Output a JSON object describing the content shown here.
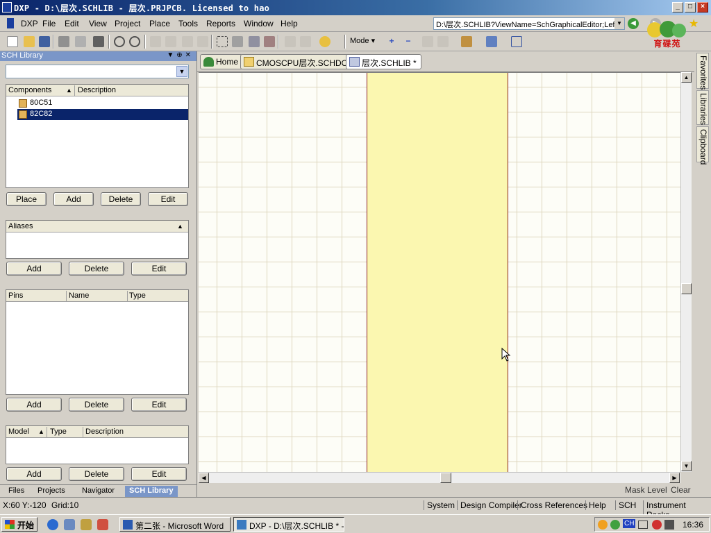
{
  "window": {
    "title": "DXP - D:\\层次.SCHLIB - 层次.PRJPCB. Licensed to hao",
    "min": "_",
    "max": "□",
    "close": "×"
  },
  "menu": {
    "items": [
      "DXP",
      "File",
      "Edit",
      "View",
      "Project",
      "Place",
      "Tools",
      "Reports",
      "Window",
      "Help"
    ],
    "path": "D:\\层次.SCHLIB?ViewName=SchGraphicalEditor;Left="
  },
  "toolbar": {
    "mode_label": "Mode ▾"
  },
  "logo": {
    "text": "育碟苑"
  },
  "panel": {
    "title": "SCH Library",
    "components": {
      "headers": [
        "Components",
        "Description"
      ],
      "items": [
        "80C51",
        "82C82"
      ],
      "selected_index": 1,
      "buttons": [
        "Place",
        "Add",
        "Delete",
        "Edit"
      ]
    },
    "aliases": {
      "header": "Aliases",
      "buttons": [
        "Add",
        "Delete",
        "Edit"
      ]
    },
    "pins": {
      "headers": [
        "Pins",
        "Name",
        "Type"
      ],
      "buttons": [
        "Add",
        "Delete",
        "Edit"
      ]
    },
    "models": {
      "headers": [
        "Model",
        "Type",
        "Description"
      ],
      "buttons": [
        "Add",
        "Delete",
        "Edit"
      ]
    },
    "bottom_tabs": [
      "Files",
      "Projects",
      "Navigator",
      "SCH Library"
    ],
    "active_tab": "SCH Library"
  },
  "doc_tabs": [
    "Home",
    "CMOSCPU层次.SCHDOC",
    "层次.SCHLIB *"
  ],
  "side_tabs": [
    "Favorites",
    "Libraries",
    "Clipboard"
  ],
  "maskbar": {
    "mask_level": "Mask Level",
    "clear": "Clear"
  },
  "status": {
    "coords": "X:60 Y:-120",
    "grid": "Grid:10",
    "buttons": [
      "System",
      "Design Compiler",
      "Cross References",
      "Help",
      "SCH",
      "Instrument Racks"
    ]
  },
  "taskbar": {
    "start": "开始",
    "tasks": [
      "第二张 - Microsoft Word",
      "DXP - D:\\层次.SCHLIB * -..."
    ],
    "tray_lang": "CH",
    "clock": "16:36"
  },
  "colors": {
    "component_fill": "#fbf7b0",
    "component_border": "#8a2020",
    "selection": "#0a246a",
    "panel_header": "#7a96c8"
  }
}
